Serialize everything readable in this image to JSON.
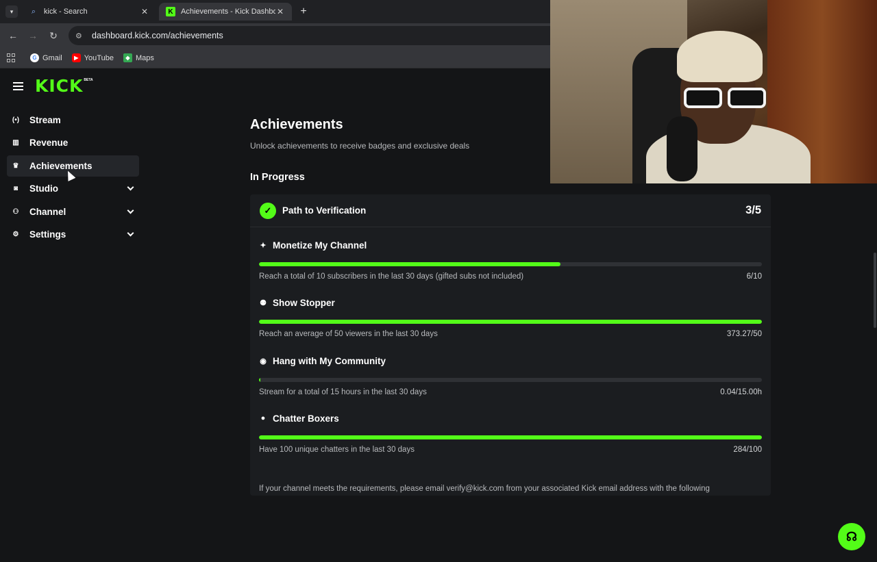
{
  "browser": {
    "tabs": [
      {
        "title": "kick - Search",
        "icon": "search-icon"
      },
      {
        "title": "Achievements - Kick Dashboard",
        "icon": "kick-favicon"
      }
    ],
    "url": "dashboard.kick.com/achievements",
    "bookmarks": [
      {
        "label": "Gmail",
        "icon": "google-icon"
      },
      {
        "label": "YouTube",
        "icon": "youtube-icon"
      },
      {
        "label": "Maps",
        "icon": "maps-icon"
      }
    ]
  },
  "brand": {
    "logo_text": "KICK",
    "beta": "BETA",
    "accent": "#53fc18"
  },
  "sidebar": {
    "items": [
      {
        "label": "Stream",
        "icon": "stream-icon",
        "expandable": false
      },
      {
        "label": "Revenue",
        "icon": "chart-icon",
        "expandable": false
      },
      {
        "label": "Achievements",
        "icon": "trophy-icon",
        "expandable": false,
        "active": true
      },
      {
        "label": "Studio",
        "icon": "studio-icon",
        "expandable": true
      },
      {
        "label": "Channel",
        "icon": "users-icon",
        "expandable": true
      },
      {
        "label": "Settings",
        "icon": "gear-icon",
        "expandable": true
      }
    ]
  },
  "main": {
    "title": "Achievements",
    "subtitle": "Unlock achievements to receive badges and exclusive deals",
    "section": "In Progress",
    "card": {
      "title": "Path to Verification",
      "count": "3/5",
      "achievements": [
        {
          "name": "Monetize My Channel",
          "icon": "sparkle-icon",
          "description": "Reach a total of 10 subscribers in the last 30 days (gifted subs not included)",
          "value": "6/10",
          "progress": 0.6
        },
        {
          "name": "Show Stopper",
          "icon": "viewers-icon",
          "description": "Reach an average of 50 viewers in the last 30 days",
          "value": "373.27/50",
          "progress": 1.0
        },
        {
          "name": "Hang with My Community",
          "icon": "broadcast-icon",
          "description": "Stream for a total of 15 hours in the last 30 days",
          "value": "0.04/15.00h",
          "progress": 0.003
        },
        {
          "name": "Chatter Boxers",
          "icon": "chat-icon",
          "description": "Have 100 unique chatters in the last 30 days",
          "value": "284/100",
          "progress": 1.0
        }
      ]
    },
    "footer_note": "If your channel meets the requirements, please email verify@kick.com from your associated Kick email address with the following"
  }
}
